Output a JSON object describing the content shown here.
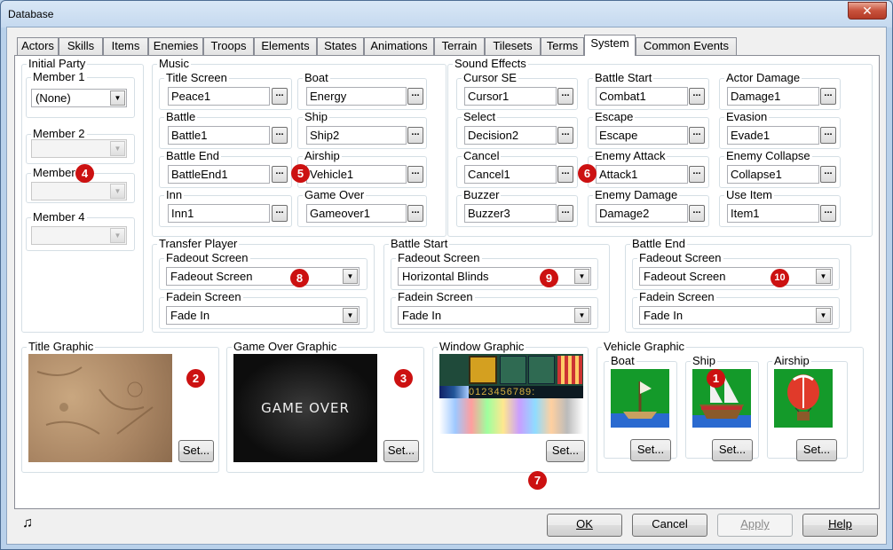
{
  "window": {
    "title": "Database",
    "close": "✕"
  },
  "tabs": [
    "Actors",
    "Skills",
    "Items",
    "Enemies",
    "Troops",
    "Elements",
    "States",
    "Animations",
    "Terrain",
    "Tilesets",
    "Terms",
    "System",
    "Common Events"
  ],
  "active_tab": "System",
  "initial_party": {
    "label": "Initial Party",
    "members": [
      {
        "label": "Member 1",
        "value": "(None)"
      },
      {
        "label": "Member 2",
        "value": ""
      },
      {
        "label": "Member 3",
        "value": ""
      },
      {
        "label": "Member 4",
        "value": ""
      }
    ]
  },
  "music": {
    "label": "Music",
    "fields": [
      {
        "label": "Title Screen",
        "value": "Peace1"
      },
      {
        "label": "Boat",
        "value": "Energy"
      },
      {
        "label": "Battle",
        "value": "Battle1"
      },
      {
        "label": "Ship",
        "value": "Ship2"
      },
      {
        "label": "Battle End",
        "value": "BattleEnd1"
      },
      {
        "label": "Airship",
        "value": "Vehicle1"
      },
      {
        "label": "Inn",
        "value": "Inn1"
      },
      {
        "label": "Game Over",
        "value": "Gameover1"
      }
    ]
  },
  "sound_effects": {
    "label": "Sound Effects",
    "fields": [
      {
        "label": "Cursor SE",
        "value": "Cursor1"
      },
      {
        "label": "Battle Start",
        "value": "Combat1"
      },
      {
        "label": "Actor Damage",
        "value": "Damage1"
      },
      {
        "label": "Select",
        "value": "Decision2"
      },
      {
        "label": "Escape",
        "value": "Escape"
      },
      {
        "label": "Evasion",
        "value": "Evade1"
      },
      {
        "label": "Cancel",
        "value": "Cancel1"
      },
      {
        "label": "Enemy Attack",
        "value": "Attack1"
      },
      {
        "label": "Enemy Collapse",
        "value": "Collapse1"
      },
      {
        "label": "Buzzer",
        "value": "Buzzer3"
      },
      {
        "label": "Enemy Damage",
        "value": "Damage2"
      },
      {
        "label": "Use Item",
        "value": "Item1"
      }
    ]
  },
  "transitions": [
    {
      "label": "Transfer Player",
      "fadeout_label": "Fadeout Screen",
      "fadeout": "Fadeout Screen",
      "fadein_label": "Fadein Screen",
      "fadein": "Fade In"
    },
    {
      "label": "Battle Start",
      "fadeout_label": "Fadeout Screen",
      "fadeout": "Horizontal Blinds",
      "fadein_label": "Fadein Screen",
      "fadein": "Fade In"
    },
    {
      "label": "Battle End",
      "fadeout_label": "Fadeout Screen",
      "fadeout": "Fadeout Screen",
      "fadein_label": "Fadein Screen",
      "fadein": "Fade In"
    }
  ],
  "graphics": {
    "title": {
      "label": "Title Graphic",
      "set": "Set..."
    },
    "gameover": {
      "label": "Game Over Graphic",
      "set": "Set...",
      "image_text": "GAME OVER"
    },
    "window": {
      "label": "Window Graphic",
      "set": "Set...",
      "digits": "0123456789:"
    },
    "vehicle": {
      "label": "Vehicle Graphic",
      "boat": "Boat",
      "ship": "Ship",
      "airship": "Airship",
      "set": "Set..."
    }
  },
  "badges": {
    "b1": "1",
    "b2": "2",
    "b3": "3",
    "b4": "4",
    "b5": "5",
    "b6": "6",
    "b7": "7",
    "b8": "8",
    "b9": "9",
    "b10": "10"
  },
  "footer": {
    "music_icon": "♫",
    "ok": "OK",
    "cancel": "Cancel",
    "apply": "Apply",
    "help": "Help"
  },
  "dots": "...",
  "arrow": "▼",
  "colors": {
    "badge": "#cc1111",
    "titlebar": "#b9d1ea"
  }
}
